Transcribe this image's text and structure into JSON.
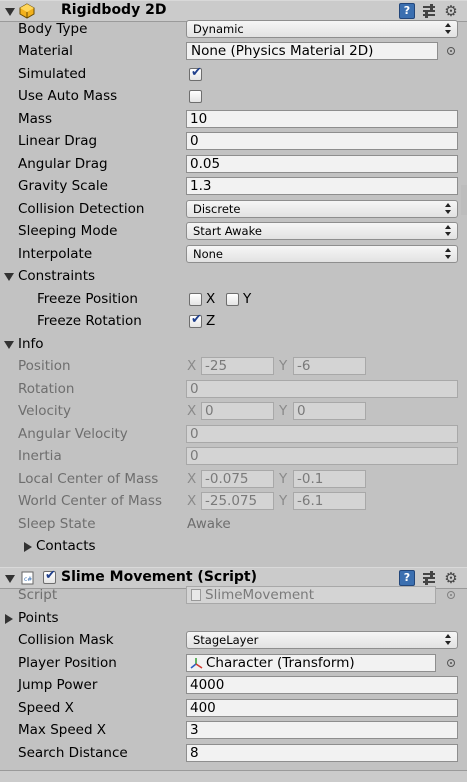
{
  "rigidbody": {
    "title": "Rigidbody 2D",
    "enabled": true,
    "body_type": {
      "label": "Body Type",
      "value": "Dynamic"
    },
    "material": {
      "label": "Material",
      "value": "None (Physics Material 2D)"
    },
    "simulated": {
      "label": "Simulated",
      "checked": true
    },
    "use_auto_mass": {
      "label": "Use Auto Mass",
      "checked": false
    },
    "mass": {
      "label": "Mass",
      "value": "10"
    },
    "linear_drag": {
      "label": "Linear Drag",
      "value": "0"
    },
    "angular_drag": {
      "label": "Angular Drag",
      "value": "0.05"
    },
    "gravity_scale": {
      "label": "Gravity Scale",
      "value": "1.3"
    },
    "collision_detection": {
      "label": "Collision Detection",
      "value": "Discrete"
    },
    "sleeping_mode": {
      "label": "Sleeping Mode",
      "value": "Start Awake"
    },
    "interpolate": {
      "label": "Interpolate",
      "value": "None"
    },
    "constraints": {
      "label": "Constraints",
      "freeze_position": {
        "label": "Freeze Position",
        "x_label": "X",
        "y_label": "Y",
        "x": false,
        "y": false
      },
      "freeze_rotation": {
        "label": "Freeze Rotation",
        "z_label": "Z",
        "z": true
      }
    },
    "info": {
      "label": "Info",
      "position": {
        "label": "Position",
        "x_label": "X",
        "x": "-25",
        "y_label": "Y",
        "y": "-6"
      },
      "rotation": {
        "label": "Rotation",
        "value": "0"
      },
      "velocity": {
        "label": "Velocity",
        "x_label": "X",
        "x": "0",
        "y_label": "Y",
        "y": "0"
      },
      "angular_velocity": {
        "label": "Angular Velocity",
        "value": "0"
      },
      "inertia": {
        "label": "Inertia",
        "value": "0"
      },
      "local_center_of_mass": {
        "label": "Local Center of Mass",
        "x_label": "X",
        "x": "-0.075",
        "y_label": "Y",
        "y": "-0.1"
      },
      "world_center_of_mass": {
        "label": "World Center of Mass",
        "x_label": "X",
        "x": "-25.075",
        "y_label": "Y",
        "y": "-6.1"
      },
      "sleep_state": {
        "label": "Sleep State",
        "value": "Awake"
      },
      "contacts": {
        "label": "Contacts"
      }
    }
  },
  "slime": {
    "title": "Slime Movement (Script)",
    "enabled": true,
    "script": {
      "label": "Script",
      "value": "SlimeMovement"
    },
    "points": {
      "label": "Points"
    },
    "collision_mask": {
      "label": "Collision Mask",
      "value": "StageLayer"
    },
    "player_position": {
      "label": "Player Position",
      "value": "Character (Transform)"
    },
    "jump_power": {
      "label": "Jump Power",
      "value": "4000"
    },
    "speed_x": {
      "label": "Speed X",
      "value": "400"
    },
    "max_speed_x": {
      "label": "Max Speed X",
      "value": "3"
    },
    "search_distance": {
      "label": "Search Distance",
      "value": "8"
    }
  },
  "icons": {
    "help": "?",
    "gear": "⚙",
    "check": "✔"
  },
  "colors": {
    "panel_bg": "#c2c2c2",
    "field_bg": "#f2f2f2",
    "help_blue": "#3b6fb0",
    "disabled_text": "#6e6e6e"
  }
}
